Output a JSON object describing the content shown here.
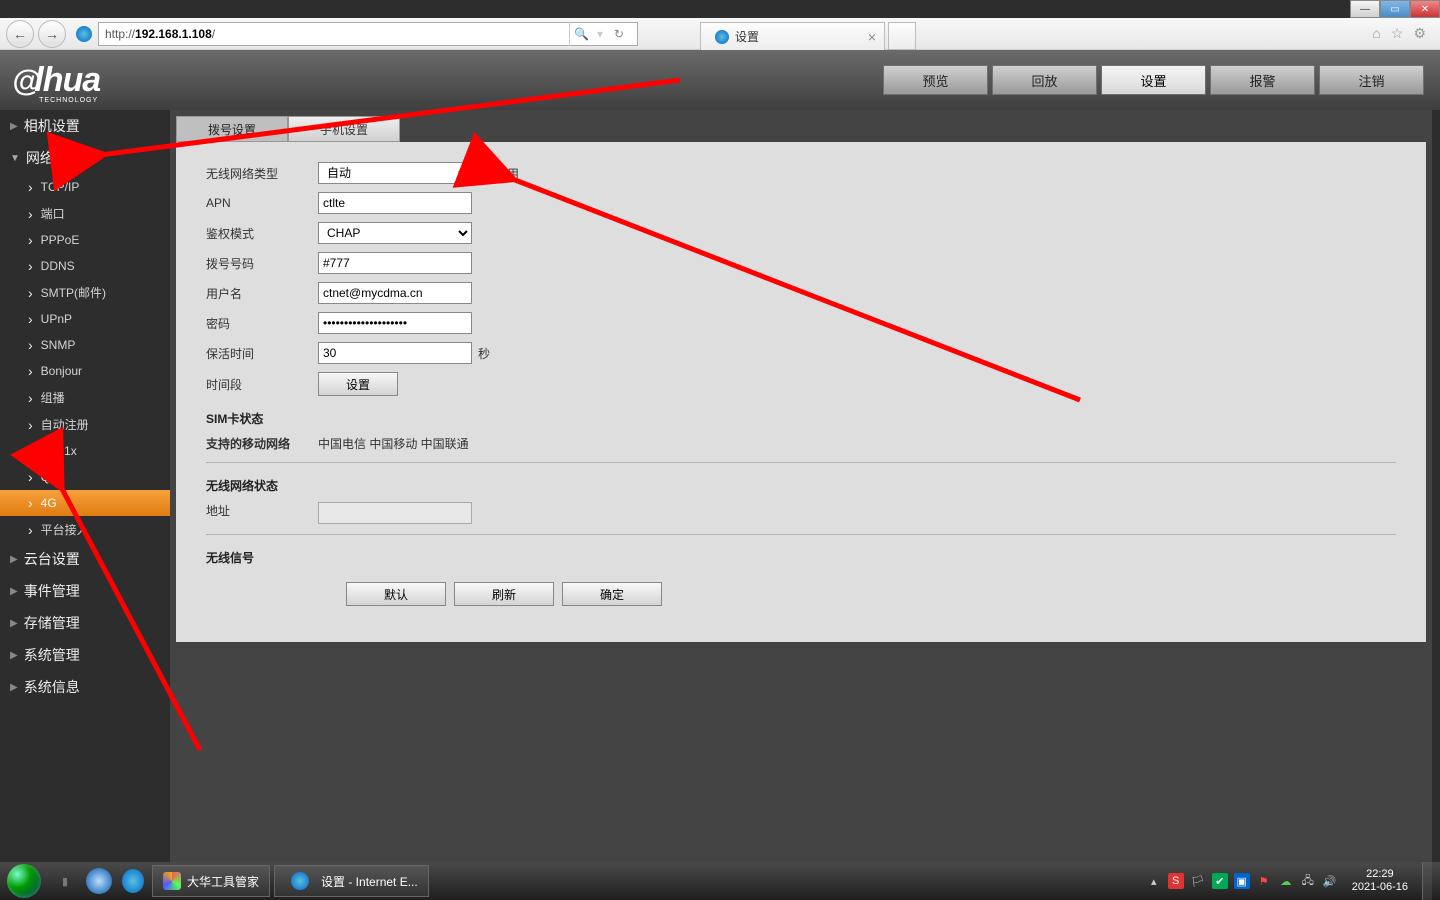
{
  "window": {
    "min": "—",
    "max": "▭",
    "close": "✕"
  },
  "browser": {
    "url_prefix": "http://",
    "url_host": "192.168.1.108",
    "url_suffix": "/",
    "tab_title": "设置",
    "tab_close": "×"
  },
  "topnav": {
    "items": [
      {
        "label": "预览"
      },
      {
        "label": "回放"
      },
      {
        "label": "设置",
        "active": true
      },
      {
        "label": "报警"
      },
      {
        "label": "注销"
      }
    ]
  },
  "sidebar": {
    "groups": [
      {
        "label": "相机设置",
        "expanded": false
      },
      {
        "label": "网络设置",
        "expanded": true,
        "items": [
          {
            "label": "TCP/IP"
          },
          {
            "label": "端口"
          },
          {
            "label": "PPPoE"
          },
          {
            "label": "DDNS"
          },
          {
            "label": "SMTP(邮件)"
          },
          {
            "label": "UPnP"
          },
          {
            "label": "SNMP"
          },
          {
            "label": "Bonjour"
          },
          {
            "label": "组播"
          },
          {
            "label": "自动注册"
          },
          {
            "label": "802.1x"
          },
          {
            "label": "QoS"
          },
          {
            "label": "4G",
            "active": true
          },
          {
            "label": "平台接入"
          }
        ]
      },
      {
        "label": "云台设置",
        "expanded": false
      },
      {
        "label": "事件管理",
        "expanded": false
      },
      {
        "label": "存储管理",
        "expanded": false
      },
      {
        "label": "系统管理",
        "expanded": false
      },
      {
        "label": "系统信息",
        "expanded": false
      }
    ]
  },
  "tabs": [
    {
      "label": "拨号设置",
      "active": true
    },
    {
      "label": "手机设置"
    }
  ],
  "form": {
    "net_type_label": "无线网络类型",
    "net_type_value": "自动",
    "enable_label": "启用",
    "enable_checked": true,
    "apn_label": "APN",
    "apn_value": "ctlte",
    "auth_label": "鉴权模式",
    "auth_value": "CHAP",
    "dial_label": "拨号号码",
    "dial_value": "#777",
    "user_label": "用户名",
    "user_value": "ctnet@mycdma.cn",
    "pass_label": "密码",
    "pass_value": "••••••••••••••••••••",
    "keep_label": "保活时间",
    "keep_value": "30",
    "keep_unit": "秒",
    "time_label": "时间段",
    "time_btn": "设置",
    "sim_title": "SIM卡状态",
    "supp_label": "支持的移动网络",
    "supp_value": "中国电信 中国移动 中国联通",
    "wstate_title": "无线网络状态",
    "addr_label": "地址",
    "signal_title": "无线信号",
    "btn_default": "默认",
    "btn_refresh": "刷新",
    "btn_ok": "确定"
  },
  "taskbar": {
    "app1": "大华工具管家",
    "app2": "设置 - Internet E...",
    "time": "22:29",
    "date": "2021-06-16"
  }
}
